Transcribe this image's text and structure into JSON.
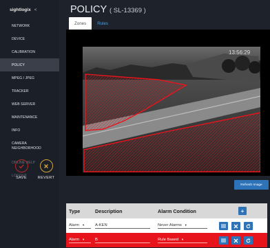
{
  "brand": {
    "name": "sightlogix",
    "chevron": "<"
  },
  "sidebar": {
    "items": [
      {
        "label": "NETWORK"
      },
      {
        "label": "DEVICE"
      },
      {
        "label": "CALIBRATION"
      },
      {
        "label": "POLICY"
      },
      {
        "label": "MPEG / JPEG"
      },
      {
        "label": "TRACKER"
      },
      {
        "label": "WEB SERVER"
      },
      {
        "label": "MAINTENANCE"
      },
      {
        "label": "INFO"
      },
      {
        "label_line1": "CAMERA",
        "label_line2": "NEIGHBORHOOD"
      },
      {
        "label": "ONLINE HELP"
      },
      {
        "label": "LOGOUT"
      }
    ],
    "save_label": "SAVE",
    "revert_label": "REVERT"
  },
  "page": {
    "title": "POLICY",
    "subtitle": "( SL-13369 )"
  },
  "tabs": [
    {
      "label": "Zones"
    },
    {
      "label": "Rules"
    }
  ],
  "image": {
    "timestamp": "13:56:29"
  },
  "refresh_label": "Refresh Image",
  "table": {
    "headers": {
      "type": "Type",
      "description": "Description",
      "condition": "Alarm Condition"
    },
    "add_symbol": "+",
    "rows": [
      {
        "type": "Alarm",
        "description": "A-KEN",
        "condition": "Never Alarms"
      },
      {
        "type": "Alarm",
        "description": "B",
        "condition": "Rule Based"
      }
    ]
  },
  "colors": {
    "sidebar_bg": "#1b1f27",
    "active_item": "#3a3f4a",
    "accent_blue": "#2e73b8",
    "zone_red": "#e8141b",
    "save_red": "#b52a2a",
    "revert_amber": "#d8a43a"
  }
}
